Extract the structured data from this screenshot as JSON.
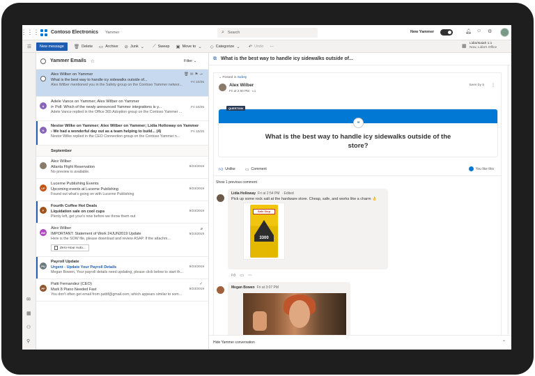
{
  "topbar": {
    "brand": "Contoso Electronics",
    "app": "Yammer",
    "search_placeholder": "Search",
    "new_yammer_label": "New Yammer"
  },
  "toolbar": {
    "new_message": "New message",
    "delete": "Delete",
    "archive": "Archive",
    "junk": "Junk",
    "sweep": "Sweep",
    "move_to": "Move to",
    "categorize": "Categorize",
    "undo": "Undo",
    "more": "···"
  },
  "calendar_peek": {
    "title": "Lidia/Isaiah 1:1",
    "subtitle": "Now, Lidia's Office"
  },
  "mail_list": {
    "title": "Yammer Emails",
    "filter": "Filter",
    "section_september": "September",
    "messages": [
      {
        "from": "Alex Wilber on Yammer",
        "subject": "What is the best way to handle icy sidewalks outside of...",
        "preview": "Alex Wilber mentioned you in the Safety group on the Contoso Yammer networ...",
        "date": "Fri 10/25"
      },
      {
        "from": "Adele Vance on Yammer; Alex Wilber on Yammer",
        "subject": "Poll: Which of the newly announced Yammer integrations is y...",
        "preview": "Adele Vance replied in the Office 365 Adoption group on the Contoso Yammer ...",
        "date": "Fri 10/25",
        "avatar": "A"
      },
      {
        "from": "Nestor Wilke on Yammer; Alex Wilber on Yammer; Lidia Holloway on Yammer",
        "subject": "We had a wonderful day out as a team helping to build...",
        "count": "(4)",
        "preview": "Nestor Wilke replied in the CEO Connection group on the Contoso Yammer n...",
        "date": "Fri 10/25",
        "avatar": "N"
      },
      {
        "from": "Alex Wilber",
        "subject": "Atlanta Flight Reservation",
        "preview": "No preview is available.",
        "date": "9/23/2019"
      },
      {
        "from": "Lucerne Publishing Events",
        "subject": "Upcoming events at Lucerne Publishing",
        "preview": "Found out what's going on with Lucerne Publishing",
        "date": "9/23/2019",
        "avatar": "LP"
      },
      {
        "from": "Fourth Coffee Hot Deals",
        "subject": "Liquidation sale on cool cups",
        "preview": "Plenty left, get your's now before we throw them out",
        "date": "9/23/2019",
        "avatar": "F"
      },
      {
        "from": "Alex Wilber",
        "subject": "IMPORTANT: Statement of Work 24JUN2019 Update",
        "preview": "Here is the SOW file, please download and review ASAP. If the attachm...",
        "date": "9/23/2019",
        "avatar": "AW",
        "attachment": "Zero-Hour Auto..."
      },
      {
        "from": "Payroll Update",
        "subject": "Urgent - Update Your Payroll Details",
        "preview": "Megan Bowen, Your payroll details need updating, please click below to start th...",
        "date": "9/23/2019",
        "avatar": "PU"
      },
      {
        "from": "Patti Fernandez (CEO)",
        "subject": "Mark 8 Piano Needed Fast",
        "preview": "You don't often get email from pattif@gmail.com, which appears similar to som...",
        "date": "9/23/2019",
        "avatar": "PF"
      }
    ]
  },
  "reading": {
    "subject": "What is the best way to handle icy sidewalks outside of...",
    "posted_in_prefix": "Posted in",
    "posted_in_group": "Safety",
    "author": "Alex Wilber",
    "meta": "Fri at 2:50 PM  ·  ◐1",
    "seen_by": "Seen by 5",
    "question_label": "QUESTION",
    "question": "What is the best way to handle icy sidewalks outside of the store?",
    "unlike": "Unlike",
    "comment": "Comment",
    "you_like": "You like this",
    "show_previous": "Show 1 previous comment",
    "comments": [
      {
        "name": "Lidia Holloway",
        "time": "Fri at 2:54 PM",
        "edited": "Edited",
        "text": "Pick up some rock salt at the hardware store. Cheap, safe, and works like a charm 👌"
      },
      {
        "name": "Megan Bowen",
        "time": "Fri at 3:07 PM"
      }
    ],
    "product_brand": "Safe Step",
    "product_number": "3300",
    "hide_conversation": "Hide Yammer conversation"
  },
  "colors": {
    "accent": "#1e5db1",
    "question_band": "#0078d4",
    "selected_row": "#c7d9ef"
  }
}
